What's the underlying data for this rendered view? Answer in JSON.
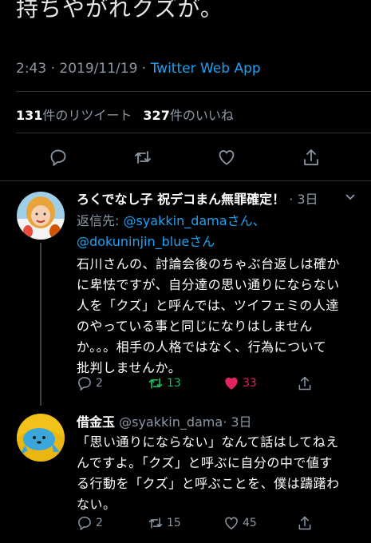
{
  "tweet": {
    "text": "持ちやがれクズが。",
    "time": "2:43",
    "date": "2019/11/19",
    "app": "Twitter Web App",
    "separator": "·",
    "retweets_count": "131",
    "retweets_label": "件のリツイート",
    "likes_count": "327",
    "likes_label": "件のいいね"
  },
  "actions": [
    "reply-icon",
    "retweet-icon",
    "like-icon",
    "share-icon"
  ],
  "reply1": {
    "name": "ろくでなし子 祝デコまん無罪確定！",
    "time": "· 3日",
    "reply_to_label": "返信先: ",
    "reply_to_user1": "@syakkin_damaさん、",
    "reply_to_user2": "@dokuninjin_blueさん",
    "lines": [
      "石川さんの、討論会後のちゃぶ台返しは確か",
      "に卑怯ですが、自分達の思い通りにならない",
      "人を「クズ」と呼んでは、ツイフェミの人達",
      "のやっている事と同じになりはしません",
      "か。。。相手の人格ではなく、行為について",
      "批判しませんか。"
    ],
    "reply_count": "2",
    "retweet_count": "13",
    "like_count": "33"
  },
  "reply2": {
    "name": "借金玉",
    "handle": "@syakkin_dama",
    "time": "· 3日",
    "lines": [
      "「思い通りにならない」なんて話はしてねえ",
      "んですよ。「クズ」と呼ぶに自分の中で値す",
      "る行動を「クズ」と呼ぶことを、僕は躊躇わ",
      "ない。"
    ],
    "reply_count": "2",
    "retweet_count": "15",
    "like_count": "45"
  },
  "colors": {
    "background": "#000000",
    "accent": "#1da1f2",
    "secondary_text": "#8b98a5",
    "retweet_active": "#17bf63",
    "like_active": "#e0245e"
  }
}
